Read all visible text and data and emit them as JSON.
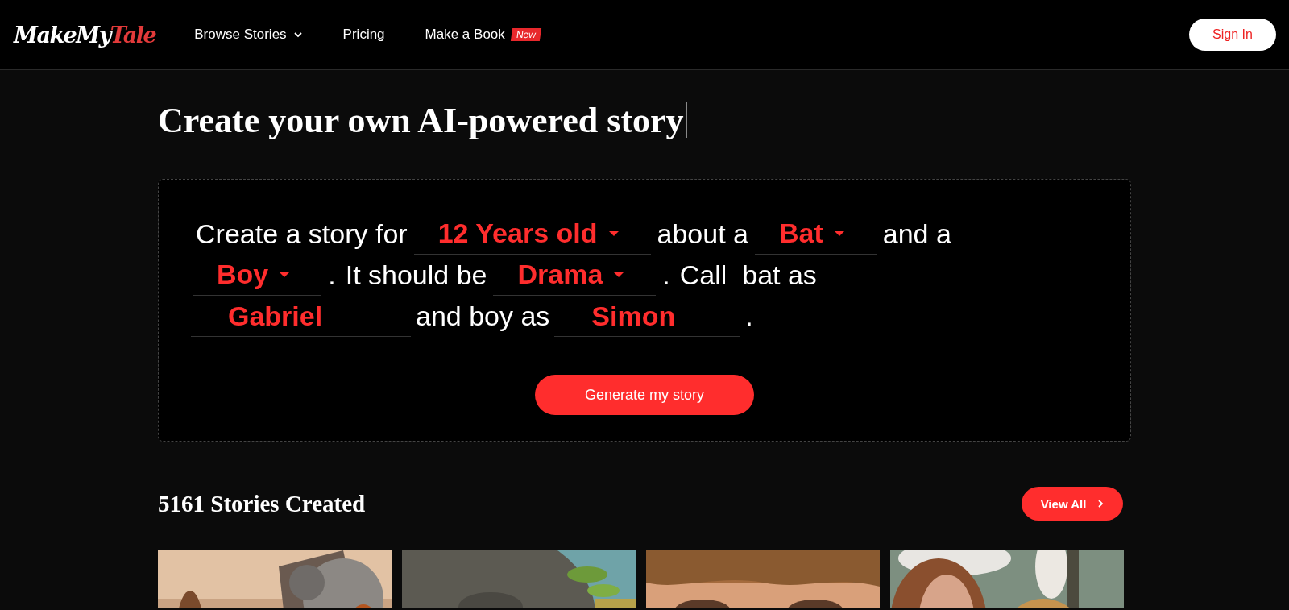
{
  "header": {
    "logo": {
      "first": "MakeMy",
      "second": "Tale"
    },
    "nav": [
      {
        "label": "Browse Stories",
        "kind": "dropdown"
      },
      {
        "label": "Pricing",
        "kind": "link"
      },
      {
        "label": "Make a Book",
        "kind": "link",
        "badge": "New"
      }
    ],
    "sign_in": "Sign In"
  },
  "heading": "Create your own AI-powered story",
  "form": {
    "lines": [
      [
        {
          "kind": "text",
          "text": "Create a story for"
        },
        {
          "kind": "select",
          "value": "12 Years old"
        },
        {
          "kind": "text",
          "text": "about a"
        },
        {
          "kind": "select",
          "value": "Bat"
        },
        {
          "kind": "text",
          "text": "and a"
        }
      ],
      [
        {
          "kind": "select",
          "value": "Boy"
        },
        {
          "kind": "text",
          "text": "."
        },
        {
          "kind": "text",
          "text": "It should be"
        },
        {
          "kind": "select",
          "value": "Drama"
        },
        {
          "kind": "text",
          "text": "."
        },
        {
          "kind": "text",
          "text": "Call  bat as"
        }
      ],
      [
        {
          "kind": "input",
          "value": "Gabriel"
        },
        {
          "kind": "text",
          "text": "and boy as"
        },
        {
          "kind": "input",
          "value": "Simon"
        },
        {
          "kind": "text",
          "text": "."
        }
      ]
    ],
    "button": "Generate my story"
  },
  "stories": {
    "title": "5161 Stories Created",
    "view_all": "View All"
  }
}
